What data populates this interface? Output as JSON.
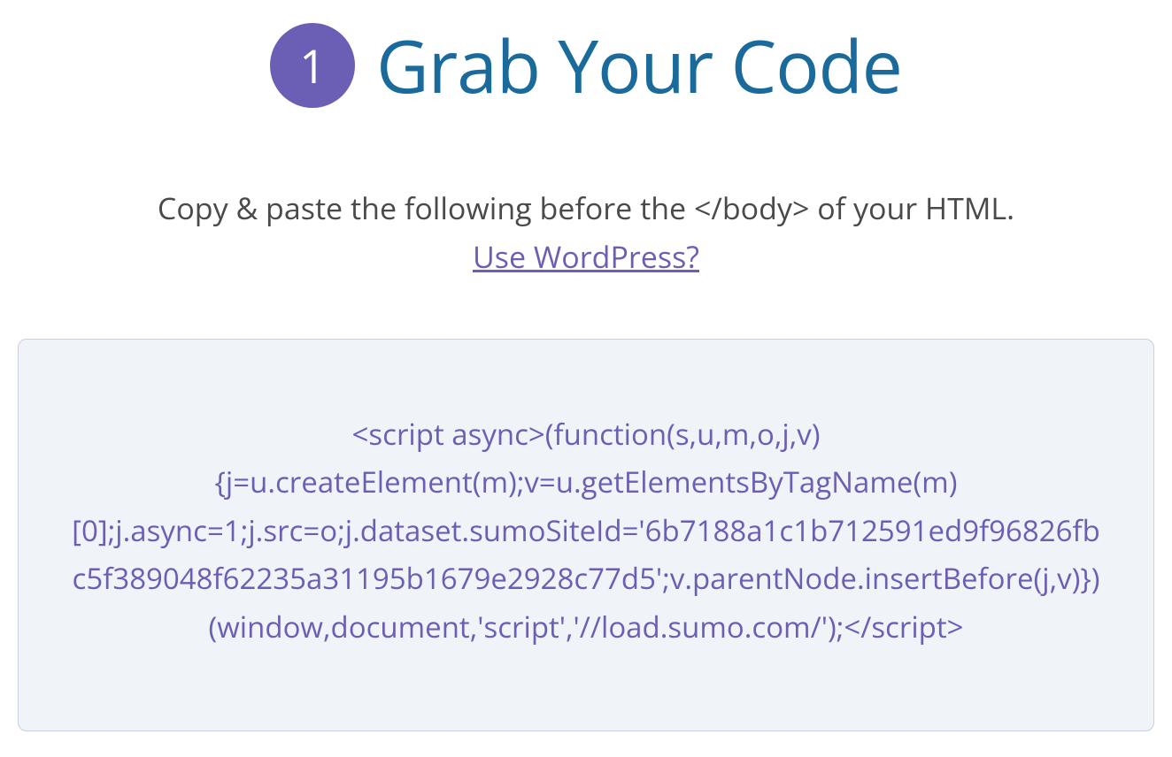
{
  "step": {
    "number": "1",
    "title": "Grab Your Code"
  },
  "instructions": {
    "text": "Copy & paste the following before the </body> of your HTML.",
    "wordpress_link": "Use WordPress?"
  },
  "code_snippet": "<script async>(function(s,u,m,o,j,v){j=u.createElement(m);v=u.getElementsByTagName(m)[0];j.async=1;j.src=o;j.dataset.sumoSiteId='6b7188a1c1b712591ed9f96826fbc5f389048f62235a31195b1679e2928c77d5';v.parentNode.insertBefore(j,v)})(window,document,'script','//load.sumo.com/');</script>"
}
